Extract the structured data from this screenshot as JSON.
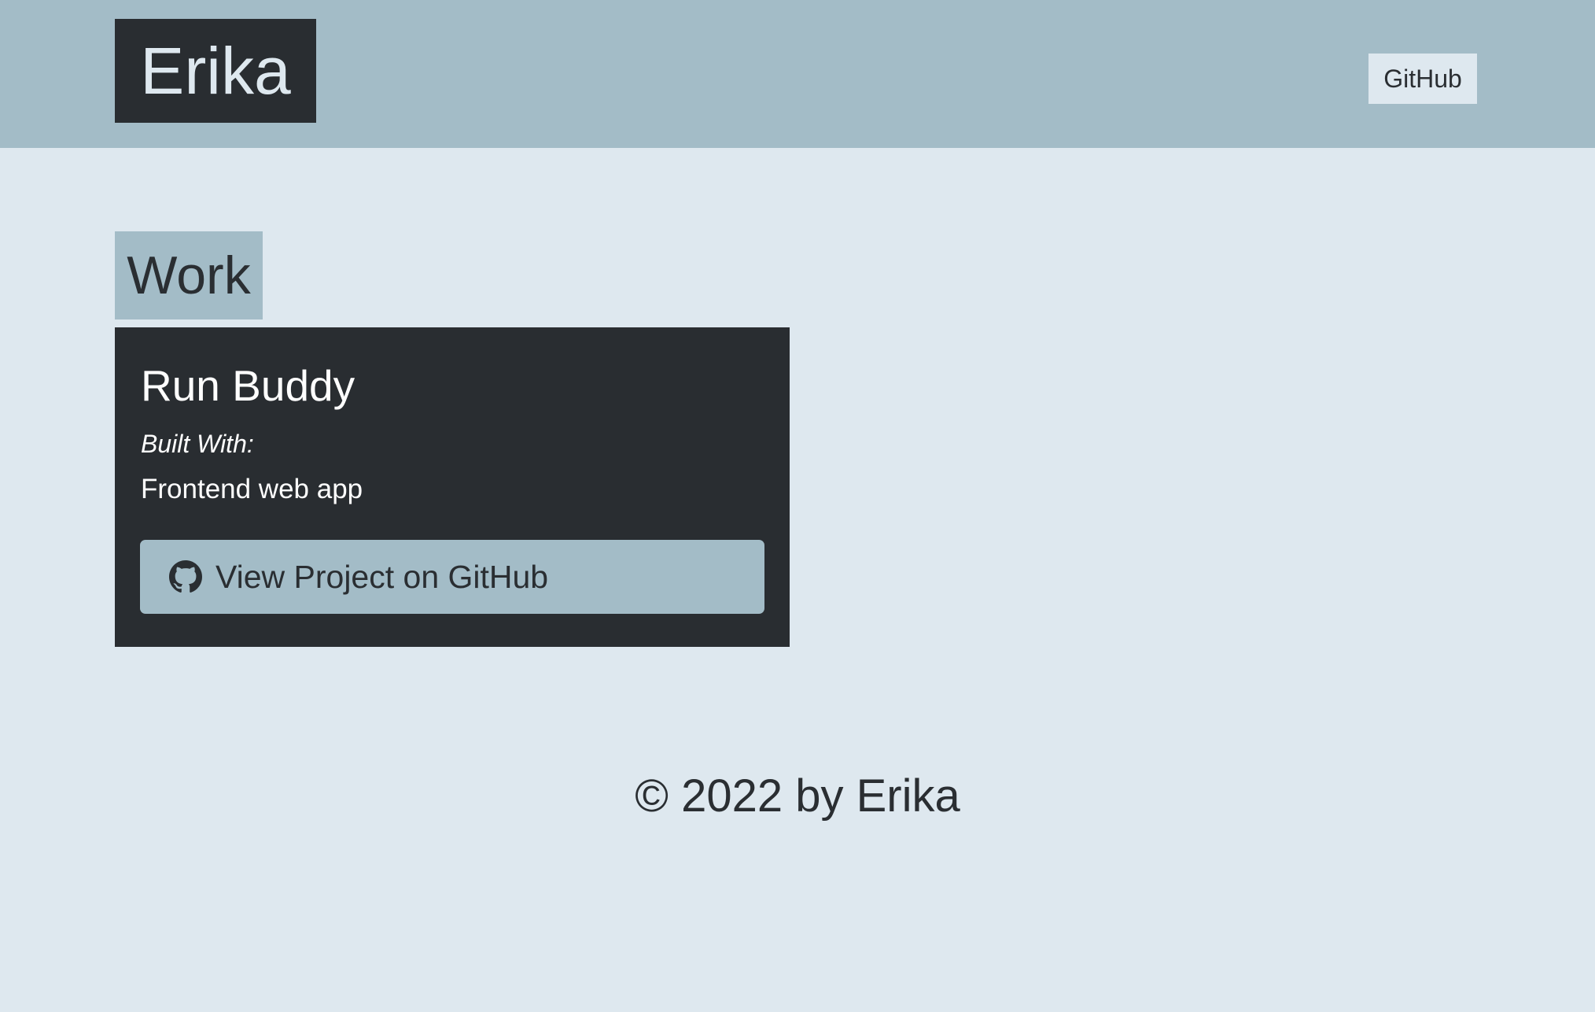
{
  "header": {
    "brand": "Erika",
    "nav": {
      "github_label": "GitHub"
    }
  },
  "work": {
    "section_title": "Work",
    "projects": [
      {
        "title": "Run Buddy",
        "built_with_label": "Built With:",
        "built_with": "Frontend web app",
        "button_label": "View Project on GitHub",
        "button_icon": "github-icon"
      }
    ]
  },
  "footer": {
    "text": "© 2022 by Erika"
  },
  "colors": {
    "page_background": "#dee8ef",
    "header_background": "#a3bcc7",
    "dark": "#292d31",
    "text": "#2a2e32"
  }
}
